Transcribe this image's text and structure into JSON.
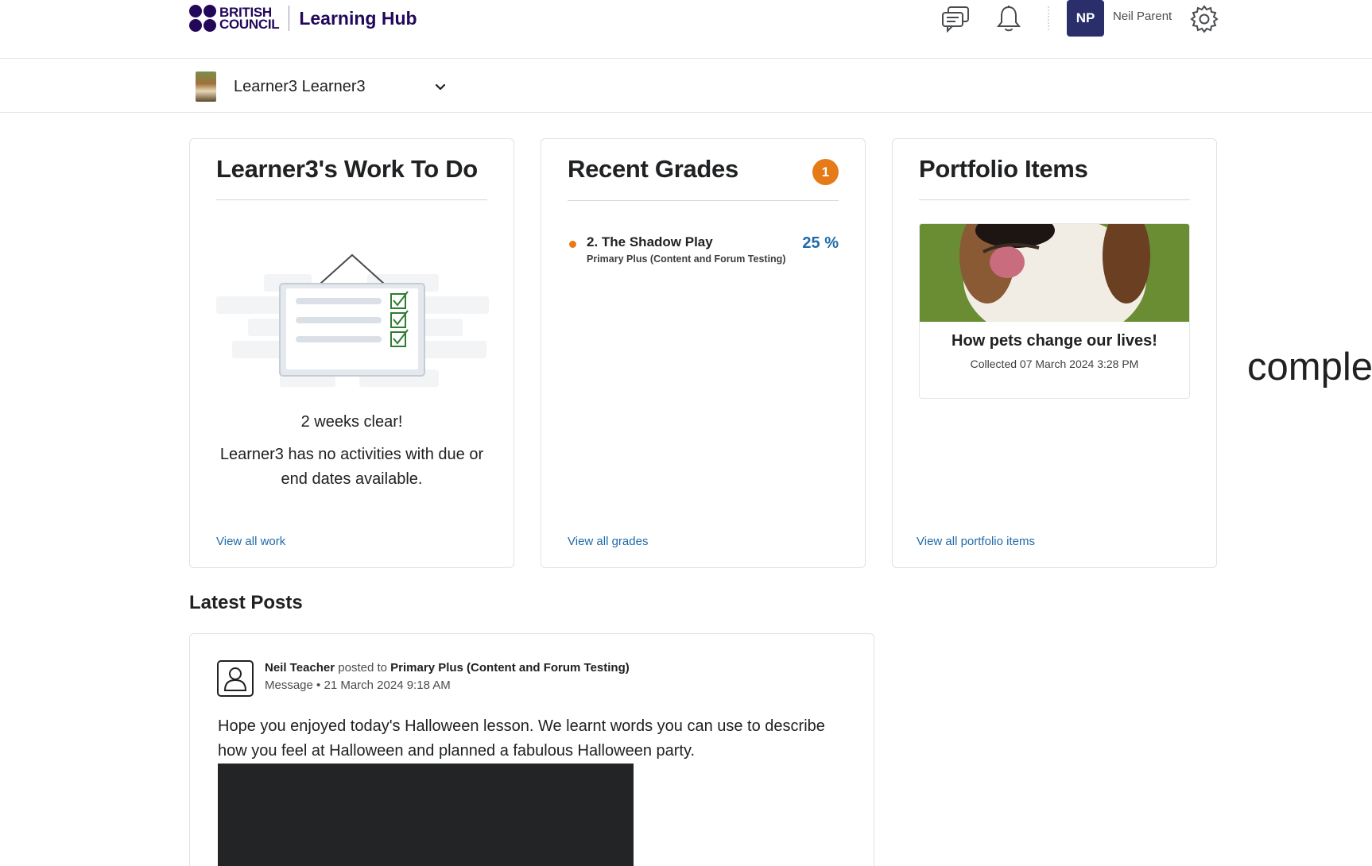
{
  "header": {
    "brand_line1": "BRITISH",
    "brand_line2": "COUNCIL",
    "app_title": "Learning Hub",
    "avatar_initials": "NP",
    "user_name": "Neil Parent",
    "icons": [
      "messages-icon",
      "notifications-icon",
      "settings-icon"
    ]
  },
  "learner_selector": {
    "selected": "Learner3 Learner3"
  },
  "work_widget": {
    "title": "Learner3's Work To Do",
    "empty_title": "2 weeks clear!",
    "empty_text": "Learner3 has no activities with due or end dates available.",
    "link": "View all work"
  },
  "grades_widget": {
    "title": "Recent Grades",
    "badge_count": "1",
    "items": [
      {
        "name": "2. The Shadow Play",
        "course": "Primary Plus (Content and Forum Testing)",
        "score": "25 %"
      }
    ],
    "link": "View all grades"
  },
  "portfolio_widget": {
    "title": "Portfolio Items",
    "item_title": "How pets change our lives!",
    "item_meta": "Collected 07 March 2024 3:28 PM",
    "link": "View all portfolio items"
  },
  "side_text": "comple",
  "latest_posts": {
    "title": "Latest Posts",
    "posts": [
      {
        "author": "Neil Teacher",
        "action": "posted to",
        "target": "Primary Plus (Content and Forum Testing)",
        "type": "Message",
        "separator": "•",
        "date": "21 March 2024 9:18 AM",
        "body": "Hope you enjoyed today's Halloween lesson. We learnt words you can use to describe how you feel at Halloween and planned a fabulous Halloween party."
      }
    ]
  },
  "colors": {
    "brand": "#23085a",
    "avatar_bg": "#2a2f6b",
    "link": "#1e6bab",
    "badge": "#e67a16"
  }
}
